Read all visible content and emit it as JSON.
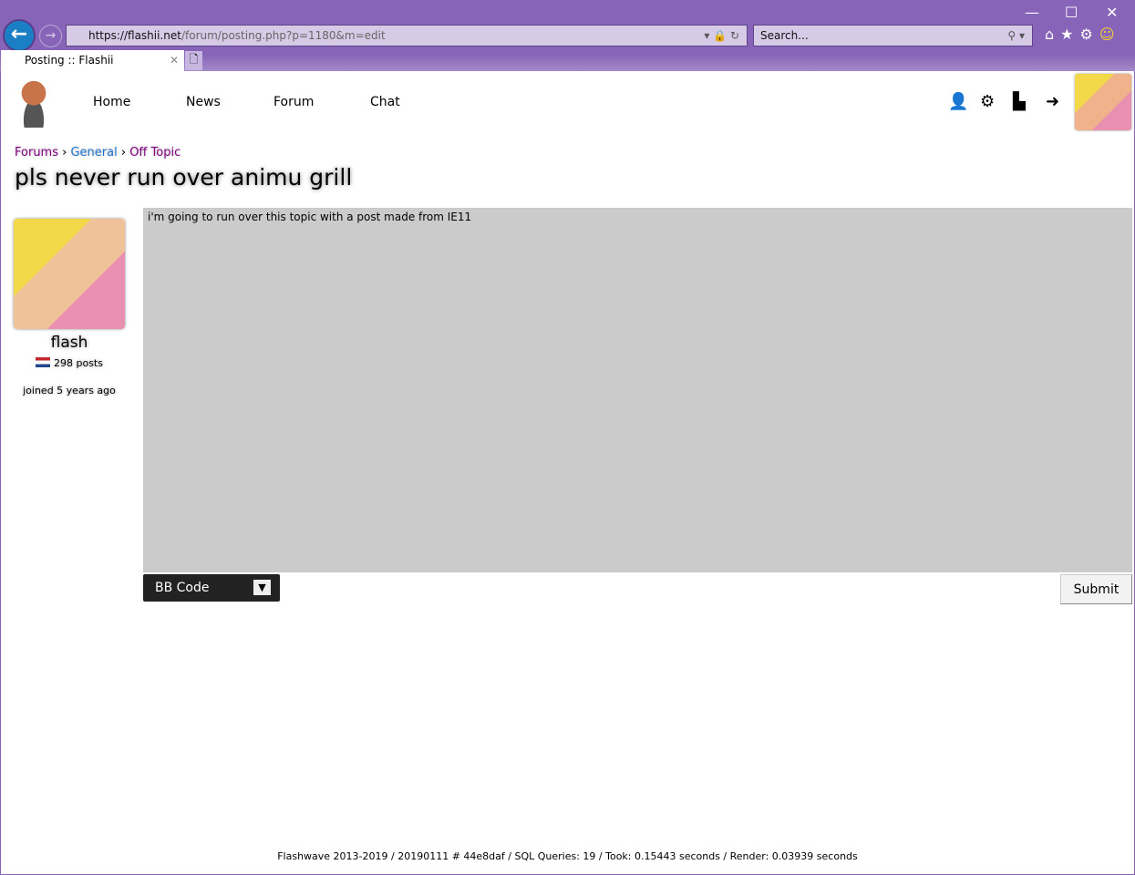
{
  "browser": {
    "url_host": "https://flashii.net",
    "url_path": "/forum/posting.php?p=1180&m=edit",
    "search_placeholder": "Search...",
    "tab_title": "Posting :: Flashii"
  },
  "nav": {
    "items": [
      "Home",
      "News",
      "Forum",
      "Chat"
    ]
  },
  "breadcrumb": [
    {
      "label": "Forums",
      "color": "#800080"
    },
    {
      "label": "General",
      "color": "#1e74d1"
    },
    {
      "label": "Off Topic",
      "color": "#800080"
    }
  ],
  "topic": {
    "title": "pls never run over animu grill"
  },
  "user": {
    "name": "flash",
    "posts": "298 posts",
    "joined": "joined 5 years ago"
  },
  "editor": {
    "text": "i'm going to run over this topic with a post made from IE11",
    "parser": "BB Code",
    "submit": "Submit"
  },
  "footer": "Flashwave 2013-2019 / 20190111 # 44e8daf / SQL Queries: 19 / Took: 0.15443 seconds / Render: 0.03939 seconds"
}
